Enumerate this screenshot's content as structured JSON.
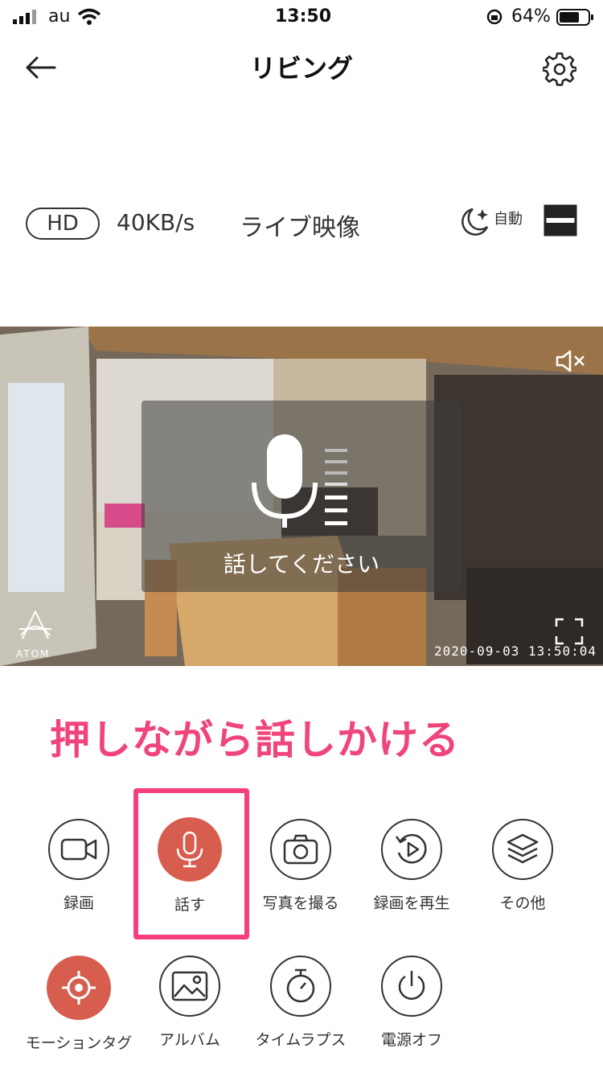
{
  "status_bar": {
    "carrier": "au",
    "time": "13:50",
    "battery": "64%"
  },
  "header": {
    "title": "リビング"
  },
  "stream_info": {
    "quality": "HD",
    "bitrate": "40KB/s",
    "mode": "ライブ映像",
    "night_mode": "自動"
  },
  "video": {
    "speak_prompt": "話してください",
    "timestamp": "2020-09-03 13:50:04",
    "brand": "ATOM"
  },
  "annotation": {
    "text": "押しながら話しかける",
    "color": "#f0457a"
  },
  "controls": {
    "row1": [
      {
        "label": "録画",
        "icon": "video-camera-icon"
      },
      {
        "label": "話す",
        "icon": "microphone-icon"
      },
      {
        "label": "写真を撮る",
        "icon": "camera-icon"
      },
      {
        "label": "録画を再生",
        "icon": "playback-icon"
      },
      {
        "label": "その他",
        "icon": "layers-icon"
      }
    ],
    "row2": [
      {
        "label": "モーションタグ",
        "icon": "target-icon"
      },
      {
        "label": "アルバム",
        "icon": "image-icon"
      },
      {
        "label": "タイムラプス",
        "icon": "stopwatch-icon"
      },
      {
        "label": "電源オフ",
        "icon": "power-icon"
      }
    ]
  },
  "colors": {
    "active": "#d75d4f",
    "highlight": "#f43e80"
  }
}
